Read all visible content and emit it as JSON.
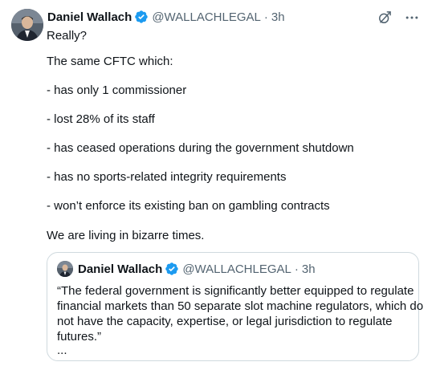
{
  "tweet": {
    "author_name": "Daniel Wallach",
    "handle": "@WALLACHLEGAL",
    "separator": "·",
    "time": "3h",
    "lines": [
      "Really?",
      "The same CFTC which:",
      "- has only 1 commissioner",
      "- lost 28% of its staff",
      "- has ceased operations during the government shutdown",
      "- has no sports-related integrity requirements",
      "- won’t enforce its existing ban on gambling contracts",
      "We are living in bizarre times."
    ],
    "more_label": "···"
  },
  "quoted": {
    "author_name": "Daniel Wallach",
    "handle": "@WALLACHLEGAL",
    "separator": "·",
    "time": "3h",
    "lines": [
      "“The federal government is significantly better equipped to regulate",
      "financial markets than 50 separate slot machine regulators, which do",
      "not have the capacity, expertise, or legal jurisdiction to regulate",
      "futures.”",
      "..."
    ]
  },
  "colors": {
    "text": "#0f1419",
    "secondary": "#536471",
    "verified": "#1d9bf0",
    "border": "#cfd9de"
  },
  "icons": {
    "verified": "verified-badge-icon",
    "grok": "grok-icon",
    "more": "more-icon"
  }
}
